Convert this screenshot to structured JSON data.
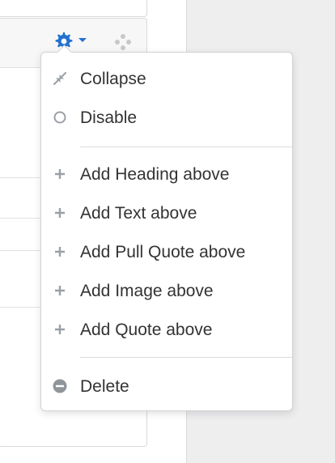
{
  "menu": {
    "items": [
      {
        "label": "Collapse",
        "icon": "collapse-icon"
      },
      {
        "label": "Disable",
        "icon": "circle-icon"
      },
      {
        "label": "Add Heading above",
        "icon": "plus-icon"
      },
      {
        "label": "Add Text above",
        "icon": "plus-icon"
      },
      {
        "label": "Add Pull Quote above",
        "icon": "plus-icon"
      },
      {
        "label": "Add Image above",
        "icon": "plus-icon"
      },
      {
        "label": "Add Quote above",
        "icon": "plus-icon"
      },
      {
        "label": "Delete",
        "icon": "minus-circle-icon"
      }
    ]
  },
  "colors": {
    "accent": "#2271d1",
    "icon_gray": "#9aa0a6",
    "text": "#333333",
    "gutter": "#eeeeef"
  }
}
